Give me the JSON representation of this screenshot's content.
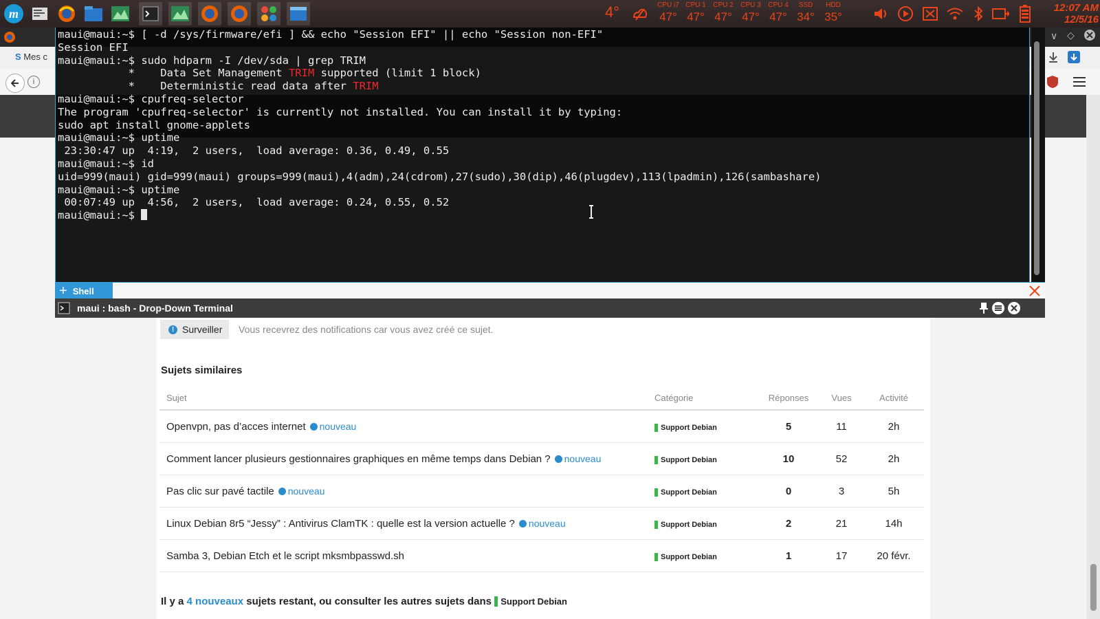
{
  "panel": {
    "weather_temp": "4°",
    "sensors": [
      {
        "label": "CPU i7",
        "value": "47°"
      },
      {
        "label": "CPU 1",
        "value": "47°"
      },
      {
        "label": "CPU 2",
        "value": "47°"
      },
      {
        "label": "CPU 3",
        "value": "47°"
      },
      {
        "label": "CPU 4",
        "value": "47°"
      },
      {
        "label": "SSD",
        "value": "34°"
      },
      {
        "label": "HDD",
        "value": "35°"
      }
    ],
    "clock_time": "12:07 AM",
    "clock_date": "12/5/16",
    "accent_color": "#e8451a"
  },
  "browser": {
    "bookmark_label": "Mes c"
  },
  "terminal": {
    "lines": [
      "maui@maui:~$ [ -d /sys/firmware/efi ] && echo \"Session EFI\" || echo \"Session non-EFI\"",
      "Session EFI",
      "maui@maui:~$ sudo hdparm -I /dev/sda | grep TRIM",
      "hl:           *    Data Set Management |TRIM| supported (limit 1 block)",
      "hl:           *    Deterministic read data after |TRIM|",
      "maui@maui:~$ cpufreq-selector",
      "The program 'cpufreq-selector' is currently not installed. You can install it by typing:",
      "sudo apt install gnome-applets",
      "maui@maui:~$ uptime",
      " 23:30:47 up  4:19,  2 users,  load average: 0.36, 0.49, 0.55",
      "maui@maui:~$ id",
      "uid=999(maui) gid=999(maui) groups=999(maui),4(adm),24(cdrom),27(sudo),30(dip),46(plugdev),113(lpadmin),126(sambashare)",
      "maui@maui:~$ uptime",
      " 00:07:49 up  4:56,  2 users,  load average: 0.24, 0.55, 0.52",
      "cursor:maui@maui:~$ "
    ],
    "tab_label": "Shell",
    "window_title": "maui : bash - Drop-Down Terminal"
  },
  "forum": {
    "watch_button": "Surveiller",
    "watch_note": "Vous recevrez des notifications car vous avez créé ce sujet.",
    "similar_title": "Sujets similaires",
    "columns": [
      "Sujet",
      "Catégorie",
      "Réponses",
      "Vues",
      "Activité"
    ],
    "new_label": "nouveau",
    "topics": [
      {
        "title": "Openvpn, pas d’acces internet",
        "is_new": true,
        "category": "Support Debian",
        "replies": "5",
        "views": "11",
        "activity": "2h"
      },
      {
        "title": "Comment lancer plusieurs gestionnaires graphiques en même temps dans Debian ?",
        "is_new": true,
        "category": "Support Debian",
        "replies": "10",
        "views": "52",
        "activity": "2h"
      },
      {
        "title": "Pas clic sur pavé tactile",
        "is_new": true,
        "category": "Support Debian",
        "replies": "0",
        "views": "3",
        "activity": "5h"
      },
      {
        "title": "Linux Debian 8r5 “Jessy” : Antivirus ClamTK : quelle est la version actuelle ?",
        "is_new": true,
        "category": "Support Debian",
        "replies": "2",
        "views": "21",
        "activity": "14h"
      },
      {
        "title": "Samba 3, Debian Etch et le script mksmbpasswd.sh",
        "is_new": false,
        "category": "Support Debian",
        "replies": "1",
        "views": "17",
        "activity": "20 févr."
      }
    ],
    "more_prefix": "Il y a",
    "more_link": "4 nouveaux",
    "more_middle": "sujets restant, ou consulter les autres sujets dans",
    "more_category": "Support Debian",
    "category_color": "#3ab54a",
    "link_color": "#2a8ccc"
  }
}
